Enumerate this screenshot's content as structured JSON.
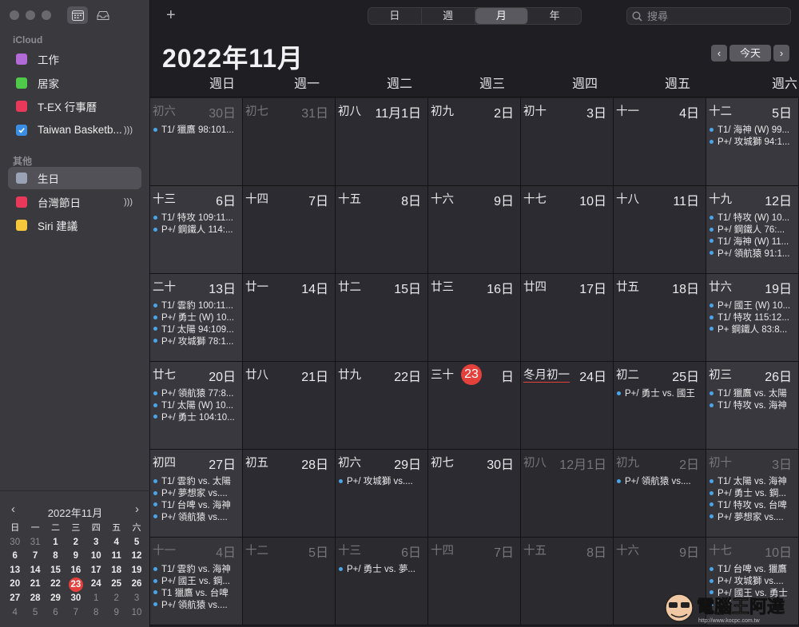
{
  "sidebar": {
    "section_icloud": "iCloud",
    "section_other": "其他",
    "calendars": [
      {
        "label": "工作",
        "color": "#b26ad6",
        "checked": false,
        "broadcast": false
      },
      {
        "label": "居家",
        "color": "#4fc94a",
        "checked": false,
        "broadcast": false
      },
      {
        "label": "T-EX 行事曆",
        "color": "#e8395a",
        "checked": false,
        "broadcast": false
      },
      {
        "label": "Taiwan Basketb...",
        "color": "#3a8ee6",
        "checked": true,
        "broadcast": true
      }
    ],
    "others": [
      {
        "label": "生日",
        "color": "#9aa3b6",
        "checked": false,
        "broadcast": false,
        "selected": true
      },
      {
        "label": "台灣節日",
        "color": "#e8395a",
        "checked": false,
        "broadcast": true
      },
      {
        "label": "Siri 建議",
        "color": "#f5c73a",
        "checked": false,
        "broadcast": false
      }
    ]
  },
  "mini": {
    "title": "2022年11月",
    "weekdays": [
      "日",
      "一",
      "二",
      "三",
      "四",
      "五",
      "六"
    ],
    "rows": [
      [
        "30",
        "31",
        "1",
        "2",
        "3",
        "4",
        "5"
      ],
      [
        "6",
        "7",
        "8",
        "9",
        "10",
        "11",
        "12"
      ],
      [
        "13",
        "14",
        "15",
        "16",
        "17",
        "18",
        "19"
      ],
      [
        "20",
        "21",
        "22",
        "23",
        "24",
        "25",
        "26"
      ],
      [
        "27",
        "28",
        "29",
        "30",
        "1",
        "2",
        "3"
      ],
      [
        "4",
        "5",
        "6",
        "7",
        "8",
        "9",
        "10"
      ]
    ],
    "today": "23"
  },
  "toolbar": {
    "add": "+",
    "views": [
      "日",
      "週",
      "月",
      "年"
    ],
    "active_view": "月",
    "search_placeholder": "搜尋"
  },
  "header": {
    "month_title": "2022年11月",
    "today_label": "今天",
    "prev": "‹",
    "next": "›"
  },
  "weekdays": [
    "週日",
    "週一",
    "週二",
    "週三",
    "週四",
    "週五",
    "週六"
  ],
  "weeks": [
    [
      {
        "lunar": "初六",
        "day": "30日",
        "out": true,
        "events": [
          "T1/ 獵鷹 98:101..."
        ]
      },
      {
        "lunar": "初七",
        "day": "31日",
        "out": true,
        "events": []
      },
      {
        "lunar": "初八",
        "day": "11月1日",
        "events": []
      },
      {
        "lunar": "初九",
        "day": "2日",
        "events": []
      },
      {
        "lunar": "初十",
        "day": "3日",
        "events": []
      },
      {
        "lunar": "十一",
        "day": "4日",
        "events": []
      },
      {
        "lunar": "十二",
        "day": "5日",
        "events": [
          "T1/ 海神 (W) 99...",
          "P+/ 攻城獅 94:1..."
        ]
      }
    ],
    [
      {
        "lunar": "十三",
        "day": "6日",
        "events": [
          "T1/ 特攻 109:11...",
          "P+/ 鋼鐵人 114:..."
        ]
      },
      {
        "lunar": "十四",
        "day": "7日",
        "events": []
      },
      {
        "lunar": "十五",
        "day": "8日",
        "events": []
      },
      {
        "lunar": "十六",
        "day": "9日",
        "events": []
      },
      {
        "lunar": "十七",
        "day": "10日",
        "events": []
      },
      {
        "lunar": "十八",
        "day": "11日",
        "events": []
      },
      {
        "lunar": "十九",
        "day": "12日",
        "events": [
          "T1/ 特攻 (W) 10...",
          "P+/ 鋼鐵人 76:...",
          "T1/ 海神 (W) 11...",
          "P+/ 領航猿 91:1..."
        ]
      }
    ],
    [
      {
        "lunar": "二十",
        "day": "13日",
        "events": [
          "T1/ 雲豹 100:11...",
          "P+/ 勇士 (W) 10...",
          "T1/ 太陽 94:109...",
          "P+/ 攻城獅 78:1..."
        ]
      },
      {
        "lunar": "廿一",
        "day": "14日",
        "events": []
      },
      {
        "lunar": "廿二",
        "day": "15日",
        "events": []
      },
      {
        "lunar": "廿三",
        "day": "16日",
        "events": []
      },
      {
        "lunar": "廿四",
        "day": "17日",
        "events": []
      },
      {
        "lunar": "廿五",
        "day": "18日",
        "events": []
      },
      {
        "lunar": "廿六",
        "day": "19日",
        "events": [
          "P+/ 國王 (W) 10...",
          "T1/ 特攻 115:12...",
          "P+ 鋼鐵人 83:8..."
        ]
      }
    ],
    [
      {
        "lunar": "廿七",
        "day": "20日",
        "events": [
          "P+/ 領航猿 77:8...",
          "T1/ 太陽 (W) 10...",
          "P+/ 勇士 104:10..."
        ]
      },
      {
        "lunar": "廿八",
        "day": "21日",
        "events": []
      },
      {
        "lunar": "廿九",
        "day": "22日",
        "events": []
      },
      {
        "lunar": "三十",
        "day": "日",
        "today_num": "23",
        "events": []
      },
      {
        "lunar": "冬月初一",
        "day": "24日",
        "term": true,
        "events": []
      },
      {
        "lunar": "初二",
        "day": "25日",
        "events": [
          "P+/ 勇士 vs. 國王"
        ]
      },
      {
        "lunar": "初三",
        "day": "26日",
        "events": [
          "T1/ 獵鷹 vs. 太陽",
          "T1/ 特攻 vs. 海神"
        ]
      }
    ],
    [
      {
        "lunar": "初四",
        "day": "27日",
        "events": [
          "T1/ 雲豹 vs. 太陽",
          "P+/ 夢想家 vs....",
          "T1/ 台啤 vs. 海神",
          "P+/ 領航猿 vs...."
        ]
      },
      {
        "lunar": "初五",
        "day": "28日",
        "events": []
      },
      {
        "lunar": "初六",
        "day": "29日",
        "events": [
          "P+/ 攻城獅 vs...."
        ]
      },
      {
        "lunar": "初七",
        "day": "30日",
        "events": []
      },
      {
        "lunar": "初八",
        "day": "12月1日",
        "out": true,
        "events": []
      },
      {
        "lunar": "初九",
        "day": "2日",
        "out": true,
        "events": [
          "P+/ 領航猿 vs...."
        ]
      },
      {
        "lunar": "初十",
        "day": "3日",
        "out": true,
        "events": [
          "T1/ 太陽 vs. 海神",
          "P+/ 勇士 vs. 鋼...",
          "T1/ 特攻 vs. 台啤",
          "P+/ 夢想家 vs...."
        ]
      }
    ],
    [
      {
        "lunar": "十一",
        "day": "4日",
        "out": true,
        "events": [
          "T1/ 雲豹 vs. 海神",
          "P+/ 國王 vs. 鋼...",
          "T1 獵鷹 vs. 台啤",
          "P+/ 領航猿 vs...."
        ]
      },
      {
        "lunar": "十二",
        "day": "5日",
        "out": true,
        "events": []
      },
      {
        "lunar": "十三",
        "day": "6日",
        "out": true,
        "events": [
          "P+/ 勇士 vs. 夢..."
        ]
      },
      {
        "lunar": "十四",
        "day": "7日",
        "out": true,
        "events": []
      },
      {
        "lunar": "十五",
        "day": "8日",
        "out": true,
        "events": []
      },
      {
        "lunar": "十六",
        "day": "9日",
        "out": true,
        "events": []
      },
      {
        "lunar": "十七",
        "day": "10日",
        "out": true,
        "events": [
          "T1/ 台啤 vs. 獵鷹",
          "P+/ 攻城獅 vs....",
          "P+/ 國王 vs. 勇士",
          "T1/ ..."
        ]
      }
    ]
  ],
  "watermark": {
    "text": "電腦王阿達",
    "url": "http://www.kocpc.com.tw"
  }
}
